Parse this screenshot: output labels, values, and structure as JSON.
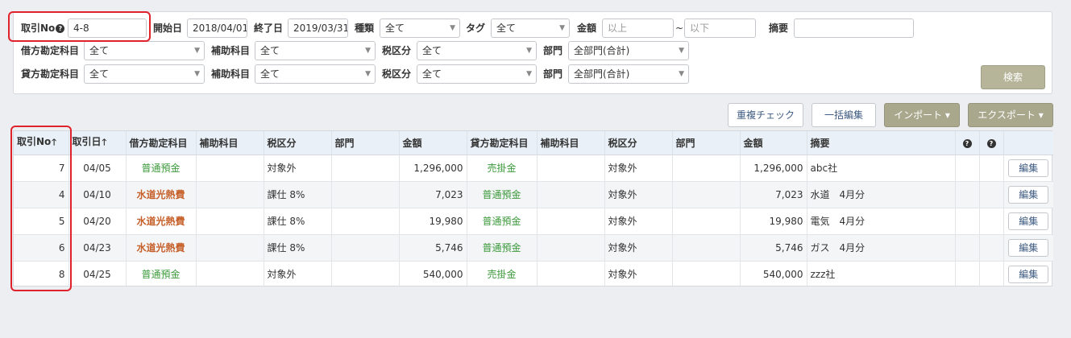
{
  "filters": {
    "row1": {
      "txn_no_label": "取引No",
      "txn_no_value": "4-8",
      "start_label": "開始日",
      "start_value": "2018/04/01",
      "end_label": "終了日",
      "end_value": "2019/03/31",
      "type_label": "種類",
      "type_value": "全て",
      "tag_label": "タグ",
      "tag_value": "全て",
      "amount_label": "金額",
      "amount_min_placeholder": "以上",
      "tilde": "~",
      "amount_max_placeholder": "以下",
      "memo_label": "摘要",
      "memo_value": ""
    },
    "row2": {
      "debit_label": "借方勘定科目",
      "debit_value": "全て",
      "sub_label": "補助科目",
      "sub_value": "全て",
      "tax_label": "税区分",
      "tax_value": "全て",
      "dept_label": "部門",
      "dept_value": "全部門(合計)"
    },
    "row3": {
      "credit_label": "貸方勘定科目",
      "credit_value": "全て",
      "sub_label": "補助科目",
      "sub_value": "全て",
      "tax_label": "税区分",
      "tax_value": "全て",
      "dept_label": "部門",
      "dept_value": "全部門(合計)"
    },
    "search_label": "検索"
  },
  "toolbar": {
    "dup_check": "重複チェック",
    "bulk_edit": "一括編集",
    "import": "インポート ▾",
    "export": "エクスポート ▾"
  },
  "table": {
    "headers": {
      "txn_no": "取引No",
      "date": "取引日",
      "debit_account": "借方勘定科目",
      "debit_sub": "補助科目",
      "debit_tax": "税区分",
      "debit_dept": "部門",
      "debit_amount": "金額",
      "credit_account": "貸方勘定科目",
      "credit_sub": "補助科目",
      "credit_tax": "税区分",
      "credit_dept": "部門",
      "credit_amount": "金額",
      "memo": "摘要"
    },
    "edit_label": "編集",
    "rows": [
      {
        "no": "7",
        "date": "04/05",
        "debit": "普通預金",
        "debit_sub": "",
        "debit_tax": "対象外",
        "debit_dept": "",
        "debit_amount": "1,296,000",
        "credit": "売掛金",
        "credit_sub": "",
        "credit_tax": "対象外",
        "credit_dept": "",
        "credit_amount": "1,296,000",
        "memo": "abc社"
      },
      {
        "no": "4",
        "date": "04/10",
        "debit": "水道光熱費",
        "debit_sub": "",
        "debit_tax": "課仕 8%",
        "debit_dept": "",
        "debit_amount": "7,023",
        "credit": "普通預金",
        "credit_sub": "",
        "credit_tax": "対象外",
        "credit_dept": "",
        "credit_amount": "7,023",
        "memo": "水道　4月分"
      },
      {
        "no": "5",
        "date": "04/20",
        "debit": "水道光熱費",
        "debit_sub": "",
        "debit_tax": "課仕 8%",
        "debit_dept": "",
        "debit_amount": "19,980",
        "credit": "普通預金",
        "credit_sub": "",
        "credit_tax": "対象外",
        "credit_dept": "",
        "credit_amount": "19,980",
        "memo": "電気　4月分"
      },
      {
        "no": "6",
        "date": "04/23",
        "debit": "水道光熱費",
        "debit_sub": "",
        "debit_tax": "課仕 8%",
        "debit_dept": "",
        "debit_amount": "5,746",
        "credit": "普通預金",
        "credit_sub": "",
        "credit_tax": "対象外",
        "credit_dept": "",
        "credit_amount": "5,746",
        "memo": "ガス　4月分"
      },
      {
        "no": "8",
        "date": "04/25",
        "debit": "普通預金",
        "debit_sub": "",
        "debit_tax": "対象外",
        "debit_dept": "",
        "debit_amount": "540,000",
        "credit": "売掛金",
        "credit_sub": "",
        "credit_tax": "対象外",
        "credit_dept": "",
        "credit_amount": "540,000",
        "memo": "zzz社"
      }
    ]
  },
  "icons": {
    "help": "question-circle-icon",
    "sort": "arrow-up-icon",
    "dropdown": "caret-down-icon"
  },
  "colors": {
    "highlight": "#e0222c",
    "primary_button": "#b7b599",
    "account_green": "#3c9a3c",
    "account_orange": "#c6602a",
    "header_bg": "#e9f0f7"
  }
}
